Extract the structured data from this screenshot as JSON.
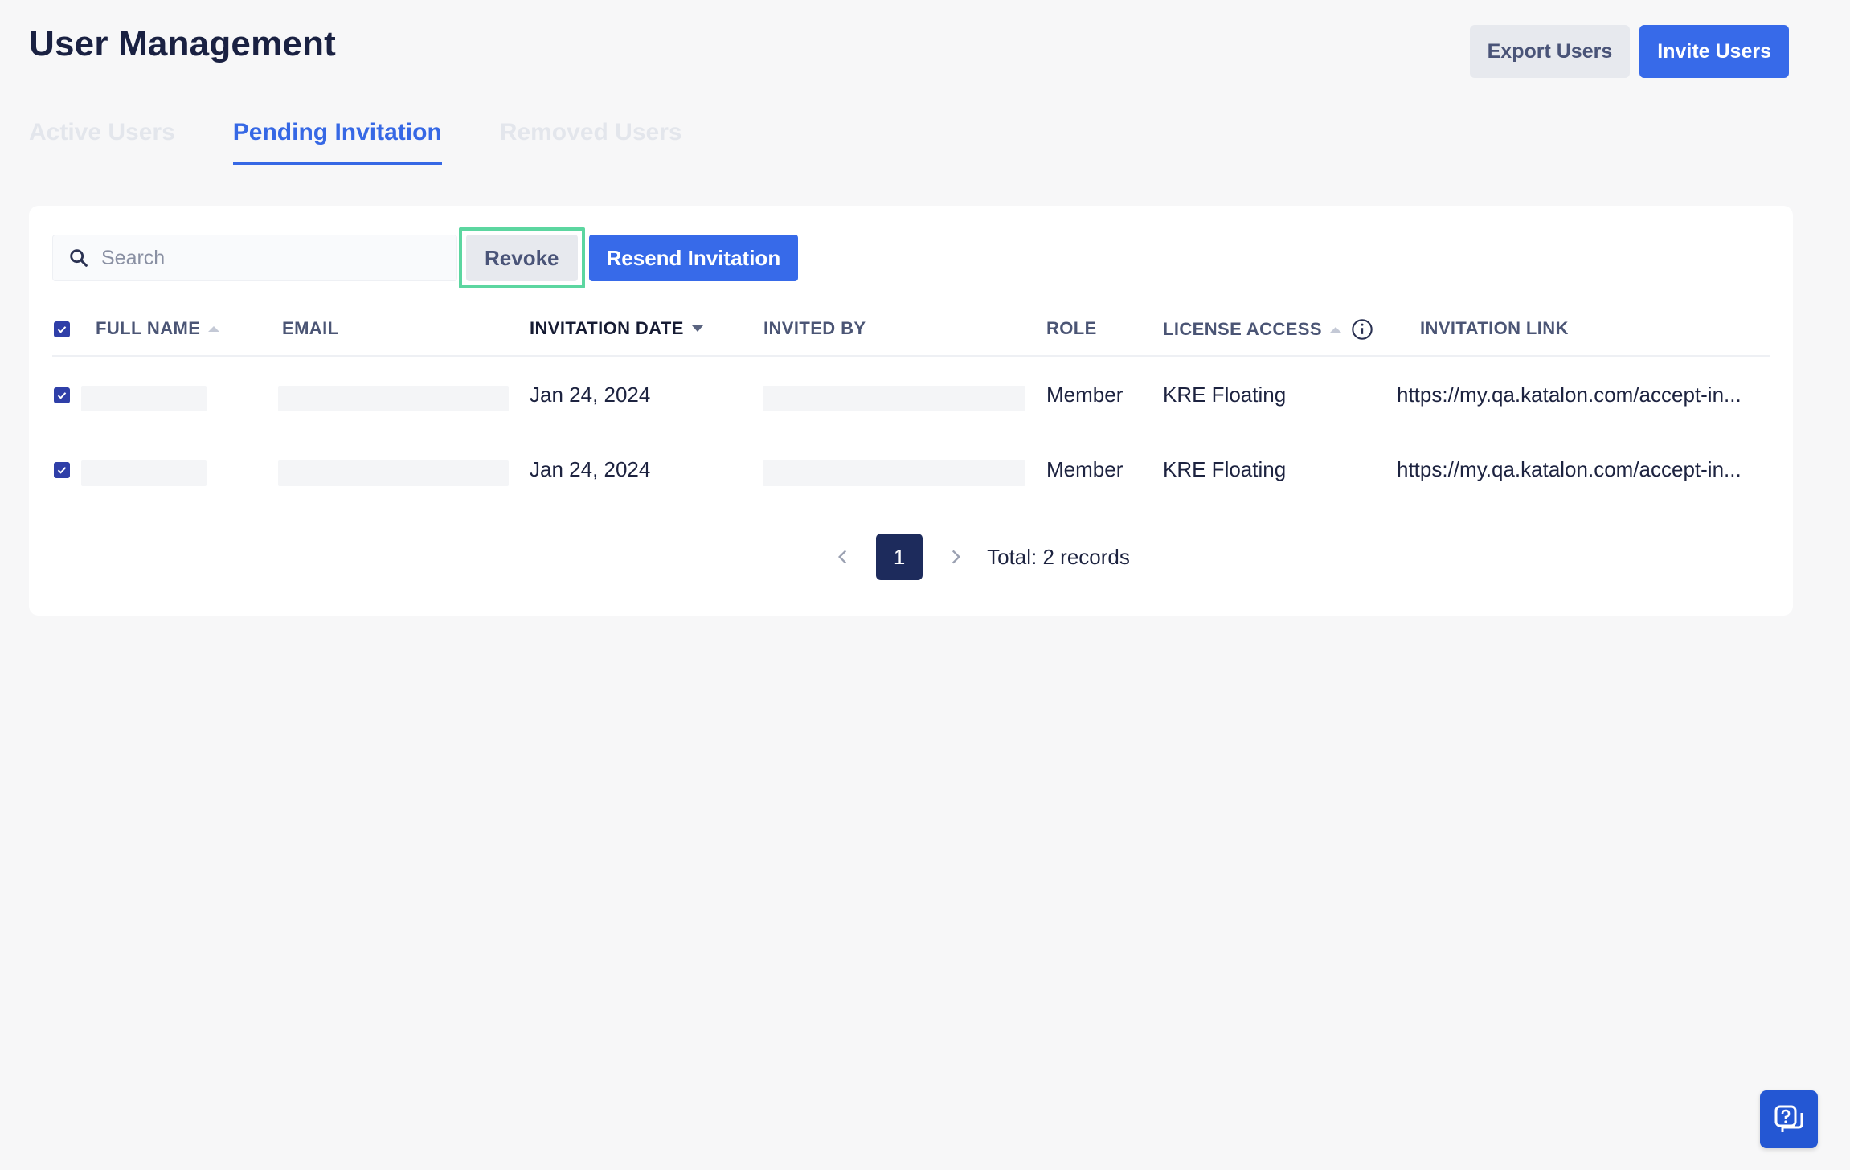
{
  "header": {
    "title": "User Management",
    "export_label": "Export Users",
    "invite_label": "Invite Users"
  },
  "tabs": [
    {
      "label": "Active Users",
      "active": false
    },
    {
      "label": "Pending Invitation",
      "active": true
    },
    {
      "label": "Removed Users",
      "active": false
    }
  ],
  "toolbar": {
    "search_placeholder": "Search",
    "search_value": "",
    "revoke_label": "Revoke",
    "resend_label": "Resend Invitation"
  },
  "table": {
    "columns": [
      "FULL NAME",
      "EMAIL",
      "INVITATION DATE",
      "INVITED BY",
      "ROLE",
      "LICENSE ACCESS",
      "INVITATION LINK"
    ],
    "all_selected": true,
    "rows": [
      {
        "selected": true,
        "full_name": "",
        "email": "",
        "invitation_date": "Jan 24, 2024",
        "invited_by": "",
        "role": "Member",
        "license_access": "KRE Floating",
        "invitation_link": "https://my.qa.katalon.com/accept-in..."
      },
      {
        "selected": true,
        "full_name": "",
        "email": "",
        "invitation_date": "Jan 24, 2024",
        "invited_by": "",
        "role": "Member",
        "license_access": "KRE Floating",
        "invitation_link": "https://my.qa.katalon.com/accept-in..."
      }
    ]
  },
  "pagination": {
    "current_page": "1",
    "total_text": "Total: 2 records"
  },
  "colors": {
    "primary": "#376ae9",
    "tab_active": "#3668e5",
    "checkbox": "#2f3fa8",
    "page_active": "#1d2b5c",
    "highlight_border": "#5cd6a0"
  },
  "icons": {
    "search": "search-icon",
    "info": "info-icon",
    "prev": "chevron-left-icon",
    "next": "chevron-right-icon",
    "help": "help-chat-icon"
  }
}
